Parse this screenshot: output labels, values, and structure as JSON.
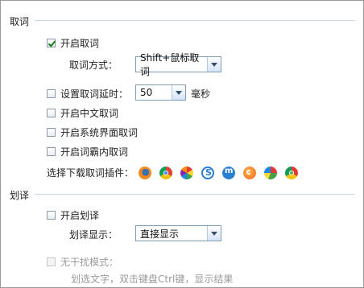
{
  "capture_section": {
    "title": "取词",
    "enable_capture": {
      "label": "开启取词",
      "checked": true
    },
    "capture_mode": {
      "label": "取词方式：",
      "value": "Shift+鼠标取词"
    },
    "capture_delay": {
      "label": "设置取词延时：",
      "value": "50",
      "unit": "毫秒",
      "checked": false
    },
    "enable_chinese": {
      "label": "开启中文取词",
      "checked": false
    },
    "enable_system_ui": {
      "label": "开启系统界面取词",
      "checked": false
    },
    "enable_inline": {
      "label": "开启词霸内取词",
      "checked": false
    },
    "plugins": {
      "label": "选择下载取词插件：",
      "icons": [
        "firefox-icon",
        "chrome-icon",
        "pinwheel-browser-icon",
        "sogou-browser-icon",
        "maxthon-icon",
        "orange-browser-icon",
        "green-browser-icon",
        "360-browser-icon"
      ]
    }
  },
  "translate_section": {
    "title": "划译",
    "enable_translate": {
      "label": "开启划译",
      "checked": false
    },
    "display_mode": {
      "label": "划译显示：",
      "value": "直接显示"
    },
    "no_disturb": {
      "label": "无干扰模式：",
      "checked": false,
      "disabled": true
    },
    "no_disturb_hint": "划选文字，双击键盘Ctrl键，显示结果"
  },
  "colors": {
    "section_line": "#c9dbe8",
    "check_mark": "#1a7f1a",
    "disabled_text": "#9a9a9a",
    "select_border": "#7f9db9"
  }
}
